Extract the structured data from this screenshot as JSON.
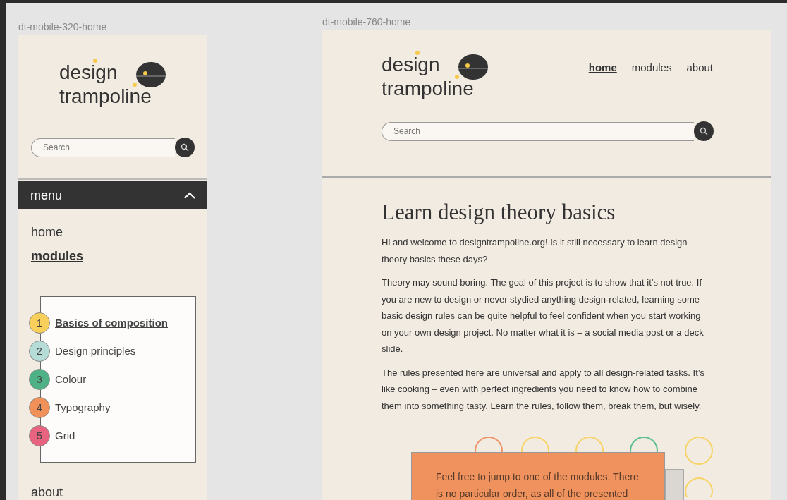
{
  "frames": [
    {
      "label": "dt-mobile-320-home",
      "logo": {
        "line_1": "design",
        "line_2": "trampoline"
      },
      "search": {
        "placeholder": "Search"
      }
    },
    {
      "label": "dt-mobile-760-home",
      "logo": {
        "line_1": "design",
        "line_2": "trampoline"
      },
      "search": {
        "placeholder": "Search"
      }
    }
  ],
  "mobile_menu": {
    "label": "menu",
    "expanded": true,
    "items": [
      {
        "label": "home",
        "selected": false
      },
      {
        "label": "modules",
        "selected": true
      },
      {
        "label": "about",
        "selected": false
      }
    ],
    "modules": [
      {
        "number": "1",
        "label": "Basics of composition",
        "color": "#f9cf5b",
        "selected": true
      },
      {
        "number": "2",
        "label": "Design principles",
        "color": "#b5dcd7",
        "selected": false
      },
      {
        "number": "3",
        "label": "Colour",
        "color": "#4fb286",
        "selected": false
      },
      {
        "number": "4",
        "label": "Typography",
        "color": "#f0915a",
        "selected": false
      },
      {
        "number": "5",
        "label": "Grid",
        "color": "#e8637f",
        "selected": false
      }
    ]
  },
  "nav": [
    {
      "label": "home",
      "selected": true
    },
    {
      "label": "modules",
      "selected": false
    },
    {
      "label": "about",
      "selected": false
    }
  ],
  "article": {
    "heading": "Learn design theory basics",
    "paragraphs": [
      "Hi and welcome to designtrampoline.org! Is it still necessary to learn design theory basics these days?",
      "Theory may sound boring. The goal of this project is to show that it’s not true. If you are new to design or never stydied anything design-related, learning some basic design rules can be quite helpful to feel confident when you start working on your own design project. No matter what it is – a social media post or a deck slide.",
      "The rules presented here are universal and apply to all design-related tasks. It’s like cooking – even with perfect ingredients you need to know how to combine them into something tasty. Learn the rules, follow them, break them, but wisely."
    ],
    "callout": "Feel free to jump to one of the modules. There is no particular order, as all of the presented"
  }
}
